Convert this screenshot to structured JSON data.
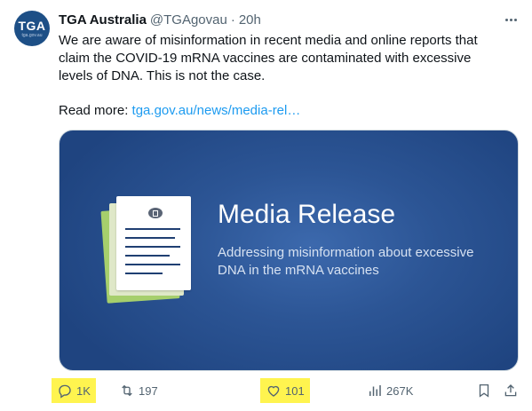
{
  "account": {
    "display_name": "TGA Australia",
    "handle": "@TGAgovau",
    "separator": "·",
    "time": "20h",
    "avatar_text": "TGA",
    "avatar_subtext": "tga.gov.au"
  },
  "tweet": {
    "text": "We are aware of misinformation in recent media and online reports that claim the COVID-19 mRNA vaccines are contaminated with excessive levels of DNA. This is not the case.",
    "read_more_label": "Read more: ",
    "link_text": "tga.gov.au/news/media-rel…"
  },
  "media": {
    "title": "Media Release",
    "subtitle": "Addressing misinformation about excessive DNA in the mRNA vaccines"
  },
  "actions": {
    "replies": "1K",
    "retweets": "197",
    "likes": "101",
    "views": "267K"
  },
  "colors": {
    "highlight": "#fff44f",
    "link": "#1d9bf0",
    "media_bg": "#2c5595",
    "doc_green": "#a6cf6c"
  }
}
